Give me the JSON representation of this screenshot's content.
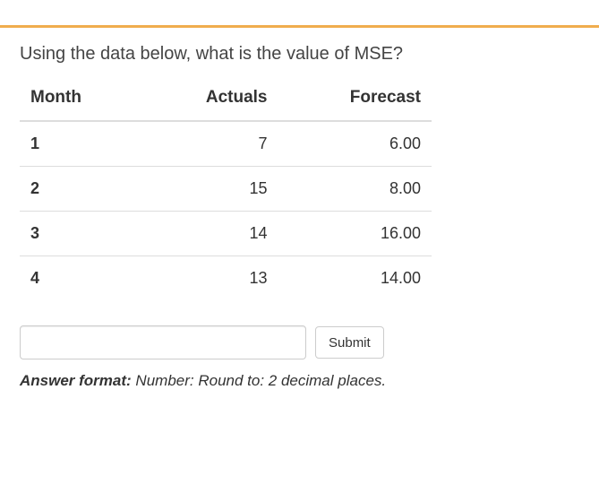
{
  "question": "Using the data below, what is the value of MSE?",
  "table": {
    "headers": {
      "month": "Month",
      "actuals": "Actuals",
      "forecast": "Forecast"
    },
    "rows": [
      {
        "month": "1",
        "actuals": "7",
        "forecast": "6.00"
      },
      {
        "month": "2",
        "actuals": "15",
        "forecast": "8.00"
      },
      {
        "month": "3",
        "actuals": "14",
        "forecast": "16.00"
      },
      {
        "month": "4",
        "actuals": "13",
        "forecast": "14.00"
      }
    ]
  },
  "answer": {
    "input_value": "",
    "submit_label": "Submit",
    "format_label": "Answer format:",
    "format_value": "Number: Round to: 2 decimal places."
  }
}
